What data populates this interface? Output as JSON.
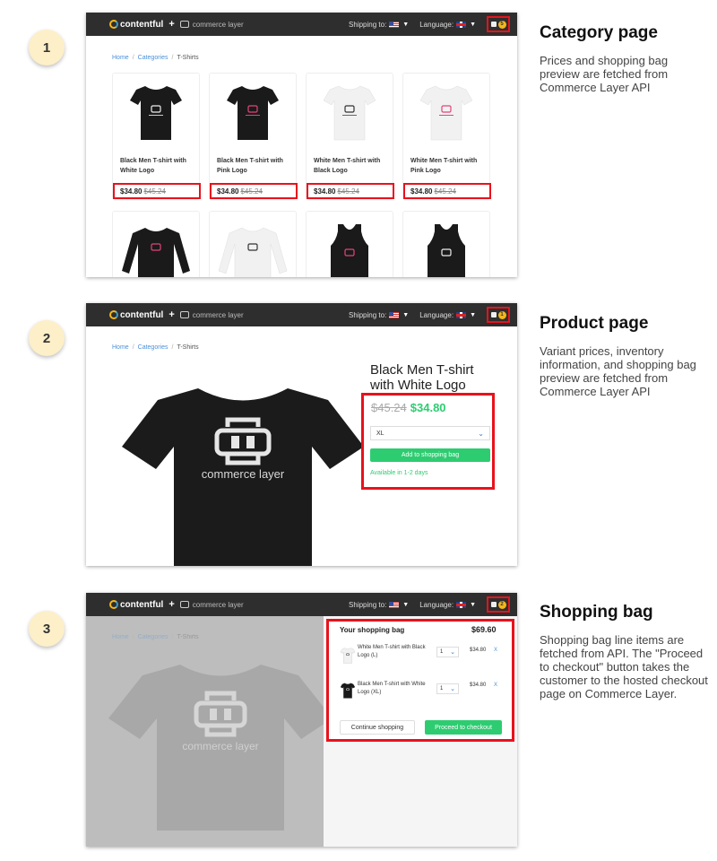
{
  "header": {
    "brand": "contentful",
    "plus": "+",
    "partner": "commerce layer",
    "shipping_label": "Shipping to:",
    "language_label": "Language:",
    "bag_count_1": "5",
    "bag_count_2": "1",
    "bag_count_3": "2"
  },
  "breadcrumb": {
    "home": "Home",
    "categories": "Categories",
    "current": "T-Shirts",
    "sep": "/"
  },
  "steps": [
    {
      "number": "1",
      "title": "Category page",
      "description": "Prices and shopping bag preview are fetched from Commerce Layer API"
    },
    {
      "number": "2",
      "title": "Product page",
      "description": "Variant prices, inventory information, and shopping bag preview are fetched from Commerce Layer API"
    },
    {
      "number": "3",
      "title": "Shopping bag",
      "description": "Shopping bag line items are fetched from API. The \"Proceed to checkout\" button takes the customer to the hosted checkout page on Commerce Layer."
    }
  ],
  "products": [
    {
      "name": "Black Men T-shirt with White Logo",
      "price": "$34.80",
      "old_price": "$45.24"
    },
    {
      "name": "Black Men T-shirt with Pink Logo",
      "price": "$34.80",
      "old_price": "$45.24"
    },
    {
      "name": "White Men T-shirt with Black Logo",
      "price": "$34.80",
      "old_price": "$45.24"
    },
    {
      "name": "White Men T-shirt with Pink Logo",
      "price": "$34.80",
      "old_price": "$45.24"
    }
  ],
  "product_page": {
    "title": "Black Men T-shirt with White Logo",
    "old_price": "$45.24",
    "price": "$34.80",
    "size": "XL",
    "add_button": "Add to shopping bag",
    "availability": "Available in 1-2 days",
    "shirt_logo_text": "commerce layer"
  },
  "bag": {
    "title": "Your shopping bag",
    "total": "$69.60",
    "items": [
      {
        "name": "White Men T-shirt with Black Logo (L)",
        "qty": "1",
        "price": "$34.80",
        "remove": "X"
      },
      {
        "name": "Black Men T-shirt with White Logo (XL)",
        "qty": "1",
        "price": "$34.80",
        "remove": "X"
      }
    ],
    "continue_button": "Continue shopping",
    "checkout_button": "Proceed to checkout"
  },
  "colors": {
    "highlight": "#e8121c",
    "green": "#2ecc71",
    "badge": "#fdefc8",
    "topbar": "#2e2e2e"
  }
}
